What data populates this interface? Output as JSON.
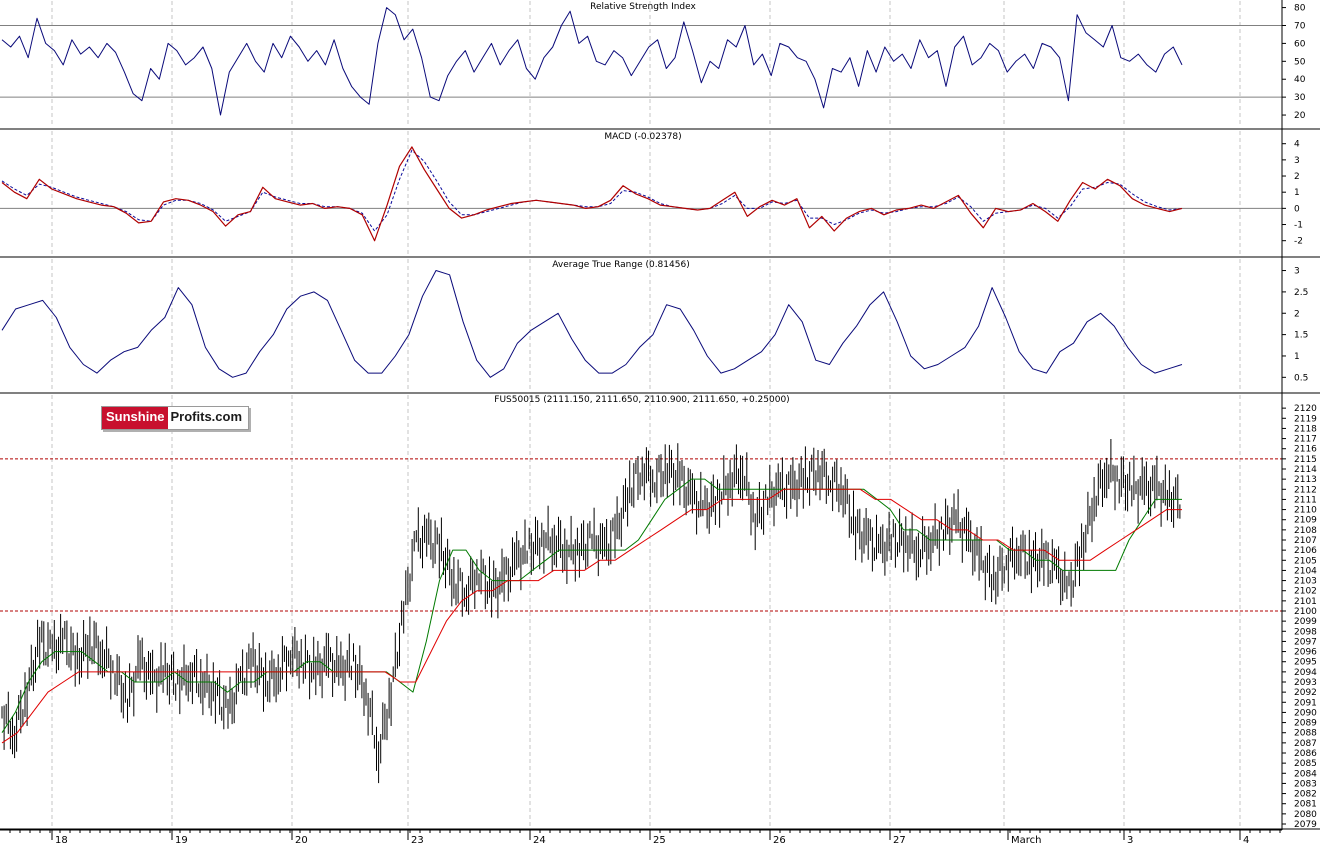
{
  "colors": {
    "rsi": "#0a0a7a",
    "macd": "#b00000",
    "macd_signal": "#0a0a9a",
    "atr": "#0a0a7a",
    "price": "#000000",
    "sma_short": "#007a00",
    "sma_long": "#e00000",
    "dashed_level": "#b00000"
  },
  "logo": {
    "part1": "Sunshine",
    "part2": "Profits.com"
  },
  "dates": [
    "18",
    "19",
    "20",
    "23",
    "24",
    "25",
    "26",
    "27",
    "March",
    "3",
    "4"
  ],
  "chart_data": [
    {
      "type": "line",
      "title": "Relative Strength Index",
      "ylim": [
        15,
        82
      ],
      "yticks": [
        20,
        30,
        40,
        50,
        60,
        70,
        80
      ],
      "reference_lines": [
        30,
        70
      ],
      "series": [
        {
          "values": [
            62,
            58,
            64,
            52,
            74,
            60,
            56,
            48,
            62,
            54,
            58,
            52,
            60,
            55,
            44,
            32,
            28,
            46,
            40,
            60,
            56,
            48,
            52,
            58,
            46,
            20,
            44,
            52,
            60,
            50,
            44,
            60,
            52,
            64,
            58,
            50,
            56,
            48,
            62,
            46,
            36,
            30,
            26,
            60,
            80,
            76,
            62,
            68,
            52,
            30,
            28,
            42,
            50,
            56,
            44,
            52,
            60,
            48,
            56,
            62,
            46,
            40,
            52,
            58,
            70,
            78,
            60,
            64,
            50,
            48,
            56,
            52,
            42,
            50,
            58,
            62,
            46,
            52,
            72,
            56,
            38,
            50,
            46,
            62,
            58,
            70,
            48,
            54,
            42,
            60,
            58,
            52,
            50,
            40,
            24,
            46,
            44,
            52,
            36,
            56,
            44,
            58,
            50,
            54,
            46,
            62,
            52,
            56,
            36,
            58,
            64,
            48,
            52,
            60,
            56,
            44,
            50,
            54,
            46,
            60,
            58,
            52,
            28,
            76,
            66,
            62,
            58,
            70,
            52,
            50,
            54,
            48,
            44,
            54,
            58,
            48
          ]
        }
      ]
    },
    {
      "type": "line",
      "title": "MACD (-0.02378)",
      "ylim": [
        -2.7,
        4.6
      ],
      "yticks": [
        -2,
        -1,
        0,
        1,
        2,
        3,
        4
      ],
      "reference_lines": [
        0
      ],
      "series": [
        {
          "values": [
            1.6,
            1.0,
            0.6,
            1.8,
            1.2,
            0.9,
            0.6,
            0.4,
            0.2,
            0.1,
            -0.3,
            -0.9,
            -0.8,
            0.4,
            0.6,
            0.5,
            0.2,
            -0.2,
            -1.1,
            -0.4,
            -0.2,
            1.3,
            0.6,
            0.4,
            0.2,
            0.3,
            0.0,
            0.1,
            0.0,
            -0.4,
            -2.0,
            0.2,
            2.6,
            3.8,
            2.4,
            1.2,
            0.0,
            -0.6,
            -0.4,
            -0.1,
            0.1,
            0.3,
            0.4,
            0.5,
            0.4,
            0.3,
            0.2,
            0.0,
            0.1,
            0.5,
            1.4,
            0.9,
            0.6,
            0.2,
            0.1,
            0.0,
            -0.1,
            0.0,
            0.5,
            1.0,
            -0.5,
            0.1,
            0.5,
            0.2,
            0.6,
            -1.2,
            -0.5,
            -1.4,
            -0.6,
            -0.2,
            0.0,
            -0.4,
            -0.1,
            0.0,
            0.2,
            0.0,
            0.4,
            0.8,
            -0.3,
            -1.2,
            0.0,
            -0.2,
            -0.1,
            0.3,
            -0.2,
            -0.8,
            0.5,
            1.6,
            1.2,
            1.8,
            1.4,
            0.6,
            0.2,
            0.0,
            -0.2,
            0.0
          ]
        },
        {
          "values": [
            1.7,
            1.2,
            0.8,
            1.5,
            1.3,
            1.0,
            0.7,
            0.5,
            0.3,
            0.1,
            -0.2,
            -0.7,
            -0.8,
            0.2,
            0.5,
            0.5,
            0.3,
            -0.1,
            -0.8,
            -0.5,
            -0.2,
            1.0,
            0.7,
            0.5,
            0.3,
            0.3,
            0.1,
            0.1,
            0.0,
            -0.3,
            -1.4,
            -0.4,
            1.8,
            3.6,
            2.9,
            1.7,
            0.4,
            -0.4,
            -0.4,
            -0.2,
            0.0,
            0.2,
            0.4,
            0.5,
            0.4,
            0.3,
            0.2,
            0.1,
            0.1,
            0.3,
            1.1,
            1.0,
            0.7,
            0.3,
            0.1,
            0.0,
            -0.1,
            0.0,
            0.3,
            0.8,
            0.0,
            0.0,
            0.4,
            0.3,
            0.5,
            -0.6,
            -0.6,
            -1.0,
            -0.7,
            -0.3,
            -0.1,
            -0.3,
            -0.2,
            0.0,
            0.1,
            0.1,
            0.3,
            0.7,
            0.1,
            -0.8,
            -0.3,
            -0.2,
            -0.1,
            0.2,
            0.0,
            -0.6,
            0.1,
            1.2,
            1.3,
            1.6,
            1.5,
            0.9,
            0.4,
            0.1,
            -0.1,
            0.0
          ]
        }
      ]
    },
    {
      "type": "line",
      "title": "Average True Range (0.81456)",
      "ylim": [
        0.25,
        3.2
      ],
      "yticks": [
        0.5,
        1.0,
        1.5,
        2.0,
        2.5,
        3.0
      ],
      "series": [
        {
          "values": [
            1.6,
            2.1,
            2.2,
            2.3,
            1.9,
            1.2,
            0.8,
            0.6,
            0.9,
            1.1,
            1.2,
            1.6,
            1.9,
            2.6,
            2.2,
            1.2,
            0.7,
            0.5,
            0.6,
            1.1,
            1.5,
            2.1,
            2.4,
            2.5,
            2.3,
            1.6,
            0.9,
            0.6,
            0.6,
            1.0,
            1.5,
            2.4,
            3.0,
            2.9,
            1.8,
            0.9,
            0.5,
            0.7,
            1.3,
            1.6,
            1.8,
            2.0,
            1.4,
            0.9,
            0.6,
            0.6,
            0.8,
            1.2,
            1.5,
            2.2,
            2.1,
            1.6,
            1.0,
            0.6,
            0.7,
            0.9,
            1.1,
            1.5,
            2.2,
            1.8,
            0.9,
            0.8,
            1.3,
            1.7,
            2.2,
            2.5,
            1.8,
            1.0,
            0.7,
            0.8,
            1.0,
            1.2,
            1.7,
            2.6,
            1.9,
            1.1,
            0.7,
            0.6,
            1.1,
            1.3,
            1.8,
            2.0,
            1.7,
            1.2,
            0.8,
            0.6,
            0.7,
            0.8
          ]
        }
      ]
    },
    {
      "type": "line",
      "title": "FUS50015 (2111.150, 2111.650, 2110.900, 2111.650, +0.25000)",
      "ylim": [
        2079,
        2121
      ],
      "yticks": [
        2079,
        2080,
        2081,
        2082,
        2083,
        2084,
        2085,
        2086,
        2087,
        2088,
        2089,
        2090,
        2091,
        2092,
        2093,
        2094,
        2095,
        2096,
        2097,
        2098,
        2099,
        2100,
        2101,
        2102,
        2103,
        2104,
        2105,
        2106,
        2107,
        2108,
        2109,
        2110,
        2111,
        2112,
        2113,
        2114,
        2115,
        2116,
        2117,
        2118,
        2119,
        2120
      ],
      "reference_lines": [
        2100,
        2115
      ],
      "series": [
        {
          "values": [
            2090,
            2088,
            2092,
            2097,
            2096,
            2097,
            2095,
            2097,
            2096,
            2094,
            2091,
            2095,
            2093,
            2094,
            2093,
            2094,
            2093,
            2092,
            2090,
            2093,
            2095,
            2093,
            2094,
            2096,
            2095,
            2094,
            2095,
            2094,
            2095,
            2092,
            2086,
            2092,
            2100,
            2107,
            2107,
            2106,
            2103,
            2102,
            2104,
            2102,
            2103,
            2105,
            2106,
            2107,
            2107,
            2106,
            2106,
            2107,
            2106,
            2108,
            2112,
            2114,
            2113,
            2114,
            2113,
            2111,
            2110,
            2111,
            2113,
            2114,
            2109,
            2111,
            2112,
            2112,
            2113,
            2114,
            2113,
            2112,
            2108,
            2107,
            2106,
            2107,
            2107,
            2106,
            2107,
            2108,
            2109,
            2107,
            2105,
            2103,
            2105,
            2106,
            2105,
            2105,
            2104,
            2102,
            2106,
            2111,
            2114,
            2113,
            2112,
            2112,
            2112,
            2111,
            2111
          ]
        },
        {
          "values": [
            2088,
            2090,
            2093,
            2095,
            2096,
            2096,
            2096,
            2095,
            2094,
            2094,
            2093,
            2093,
            2093,
            2094,
            2093,
            2093,
            2093,
            2092,
            2093,
            2093,
            2094,
            2094,
            2094,
            2095,
            2095,
            2094,
            2094,
            2094,
            2094,
            2094,
            2093,
            2092,
            2097,
            2103,
            2106,
            2106,
            2104,
            2103,
            2103,
            2103,
            2104,
            2105,
            2106,
            2106,
            2106,
            2106,
            2106,
            2106,
            2107,
            2109,
            2111,
            2112,
            2113,
            2113,
            2112,
            2112,
            2112,
            2112,
            2112,
            2112,
            2112,
            2112,
            2112,
            2112,
            2112,
            2112,
            2111,
            2110,
            2108,
            2108,
            2107,
            2107,
            2107,
            2107,
            2107,
            2107,
            2106,
            2106,
            2105,
            2105,
            2104,
            2104,
            2104,
            2104,
            2104,
            2107,
            2109,
            2111,
            2111,
            2111
          ]
        },
        {
          "values": [
            2087,
            2088,
            2090,
            2092,
            2093,
            2094,
            2094,
            2094,
            2094,
            2094,
            2094,
            2094,
            2094,
            2094,
            2094,
            2094,
            2094,
            2094,
            2094,
            2094,
            2094,
            2094,
            2094,
            2094,
            2094,
            2094,
            2093,
            2093,
            2096,
            2099,
            2101,
            2102,
            2102,
            2103,
            2103,
            2103,
            2104,
            2104,
            2104,
            2105,
            2105,
            2106,
            2107,
            2108,
            2109,
            2110,
            2110,
            2111,
            2111,
            2111,
            2111,
            2112,
            2112,
            2112,
            2112,
            2112,
            2112,
            2111,
            2111,
            2110,
            2109,
            2109,
            2108,
            2108,
            2107,
            2107,
            2106,
            2106,
            2106,
            2105,
            2105,
            2105,
            2106,
            2107,
            2108,
            2109,
            2110,
            2110
          ]
        }
      ]
    }
  ]
}
